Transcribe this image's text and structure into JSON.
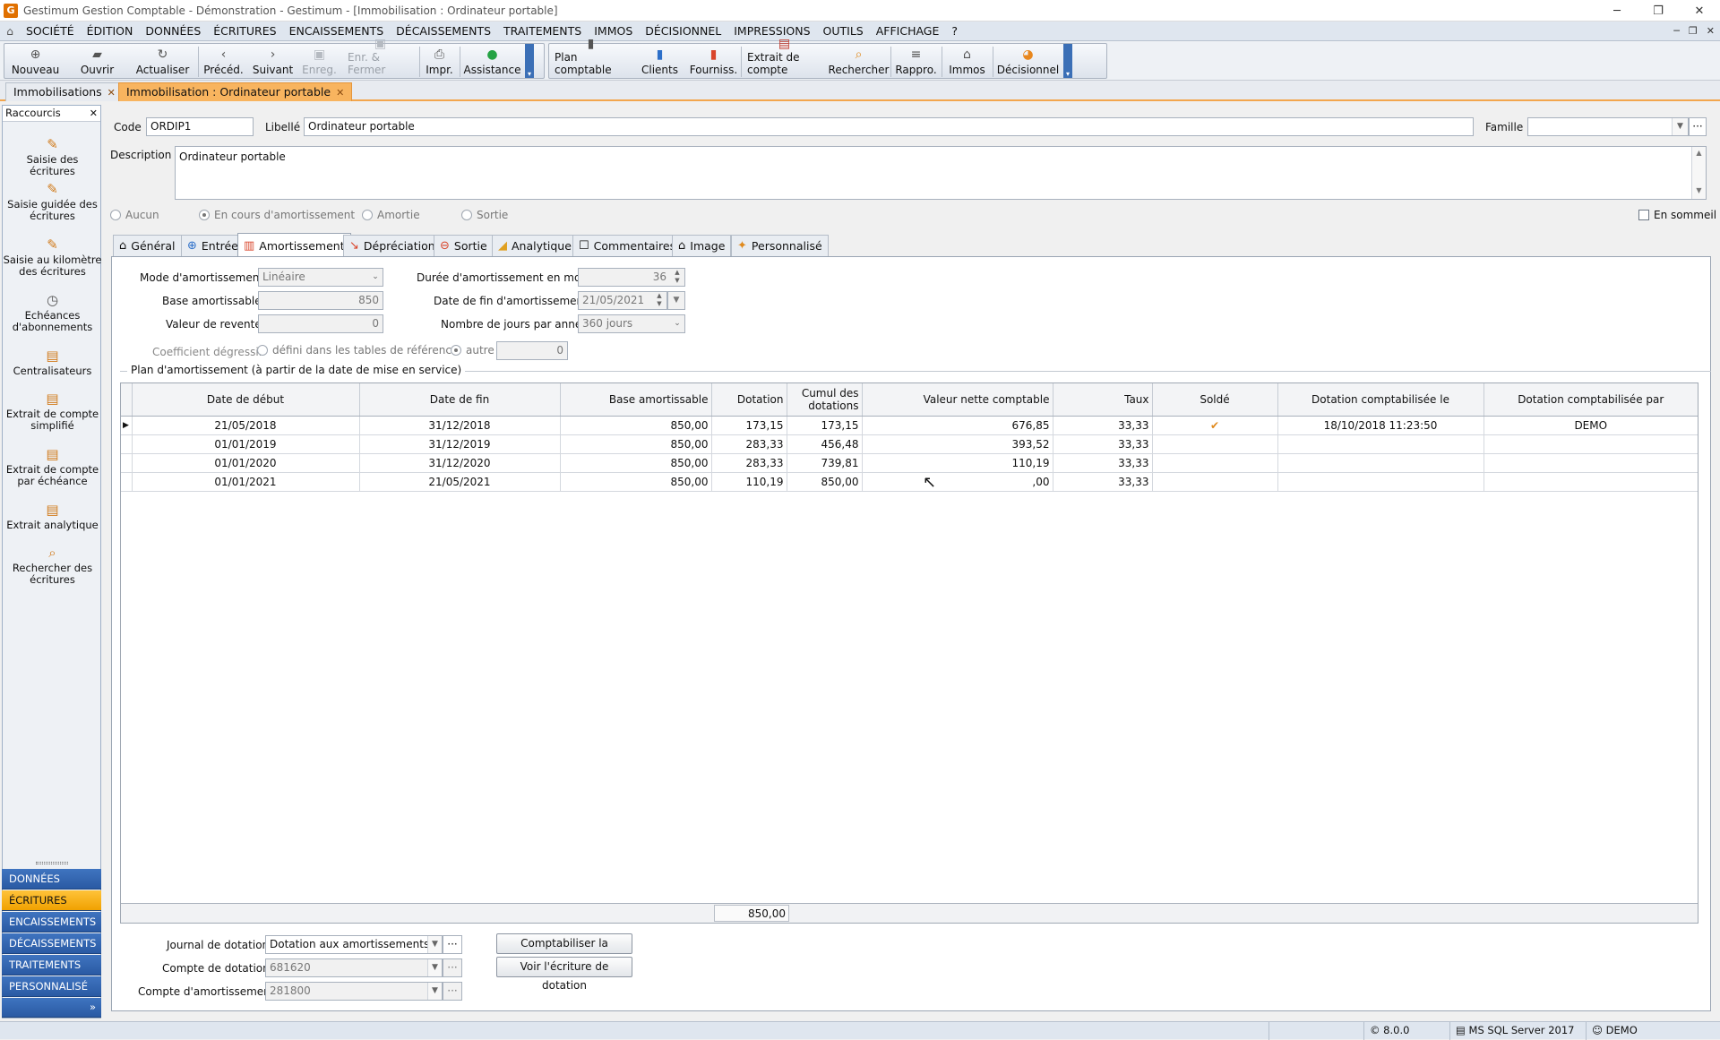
{
  "window": {
    "title": "Gestimum Gestion Comptable - Démonstration - Gestimum - [Immobilisation : Ordinateur portable]"
  },
  "menu": [
    "SOCIÉTÉ",
    "ÉDITION",
    "DONNÉES",
    "ÉCRITURES",
    "ENCAISSEMENTS",
    "DÉCAISSEMENTS",
    "TRAITEMENTS",
    "IMMOS",
    "DÉCISIONNEL",
    "IMPRESSIONS",
    "OUTILS",
    "AFFICHAGE",
    "?"
  ],
  "toolbar": {
    "nouveau": "Nouveau",
    "ouvrir": "Ouvrir",
    "actualiser": "Actualiser",
    "preced": "Précéd.",
    "suivant": "Suivant",
    "enreg": "Enreg.",
    "enr_fermer": "Enr. & Fermer",
    "impr": "Impr.",
    "assistance": "Assistance",
    "plan": "Plan comptable",
    "clients": "Clients",
    "fourniss": "Fourniss.",
    "extrait": "Extrait de compte",
    "rechercher": "Rechercher",
    "rappro": "Rappro.",
    "immos": "Immos",
    "decisionnel": "Décisionnel"
  },
  "doc_tabs": {
    "tab1": "Immobilisations",
    "tab2": "Immobilisation : Ordinateur portable"
  },
  "sidebar": {
    "header": "Raccourcis",
    "items": [
      "Saisie des écritures",
      "Saisie guidée des écritures",
      "Saisie au kilomètre des écritures",
      "Echéances d'abonnements",
      "Centralisateurs",
      "Extrait de compte simplifié",
      "Extrait de compte par échéance",
      "Extrait analytique",
      "Rechercher des écritures"
    ],
    "nav": [
      "DONNÉES",
      "ÉCRITURES",
      "ENCAISSEMENTS",
      "DÉCAISSEMENTS",
      "TRAITEMENTS",
      "PERSONNALISÉ"
    ]
  },
  "form": {
    "code_label": "Code",
    "code": "ORDIP1",
    "libelle_label": "Libellé",
    "libelle": "Ordinateur portable",
    "famille_label": "Famille",
    "famille": "",
    "description_label": "Description",
    "description": "Ordinateur portable",
    "status": {
      "aucun": "Aucun",
      "en_cours": "En cours d'amortissement",
      "amortie": "Amortie",
      "sortie": "Sortie"
    },
    "en_sommeil": "En sommeil"
  },
  "subtabs": [
    "Général",
    "Entrée",
    "Amortissement",
    "Dépréciation",
    "Sortie",
    "Analytique",
    "Commentaires",
    "Image",
    "Personnalisé"
  ],
  "amort": {
    "mode_label": "Mode d'amortissement",
    "mode": "Linéaire",
    "base_label": "Base amortissable",
    "base": "850",
    "revente_label": "Valeur de revente",
    "revente": "0",
    "duree_label": "Durée d'amortissement en mois",
    "duree": "36",
    "date_fin_label": "Date de fin d'amortissement",
    "date_fin": "21/05/2021",
    "jours_label": "Nombre de jours par année",
    "jours": "360 jours",
    "coef_label": "Coefficient dégressif",
    "coef_opt1": "défini dans les tables de référence",
    "coef_opt2": "autre",
    "coef_val": "0",
    "plan_title": "Plan d'amortissement (à partir de la date de mise en service)"
  },
  "grid": {
    "headers": [
      "Date de début",
      "Date de fin",
      "Base amortissable",
      "Dotation",
      "Cumul des dotations",
      "Valeur nette comptable",
      "Taux",
      "Soldé",
      "Dotation comptabilisée le",
      "Dotation comptabilisée par"
    ],
    "rows": [
      [
        "21/05/2018",
        "31/12/2018",
        "850,00",
        "173,15",
        "173,15",
        "676,85",
        "33,33",
        "✔",
        "18/10/2018 11:23:50",
        "DEMO"
      ],
      [
        "01/01/2019",
        "31/12/2019",
        "850,00",
        "283,33",
        "456,48",
        "393,52",
        "33,33",
        "",
        "",
        ""
      ],
      [
        "01/01/2020",
        "31/12/2020",
        "850,00",
        "283,33",
        "739,81",
        "110,19",
        "33,33",
        "",
        "",
        ""
      ],
      [
        "01/01/2021",
        "21/05/2021",
        "850,00",
        "110,19",
        "850,00",
        ",00",
        "33,33",
        "",
        "",
        ""
      ]
    ],
    "total": "850,00"
  },
  "bottom": {
    "journal_label": "Journal de dotation",
    "journal": "Dotation aux amortissements",
    "compte_dot_label": "Compte de dotation",
    "compte_dot": "681620",
    "compte_amort_label": "Compte d'amortissement",
    "compte_amort": "281800",
    "btn_comptabiliser": "Comptabiliser la dotation",
    "btn_voir": "Voir l'écriture de dotation"
  },
  "status": {
    "version": "8.0.0",
    "db": "MS SQL Server 2017",
    "user": "DEMO"
  },
  "colors": {
    "accent": "#f8b45f",
    "nav": "#2a5aa3",
    "active_nav": "#f0a100"
  }
}
